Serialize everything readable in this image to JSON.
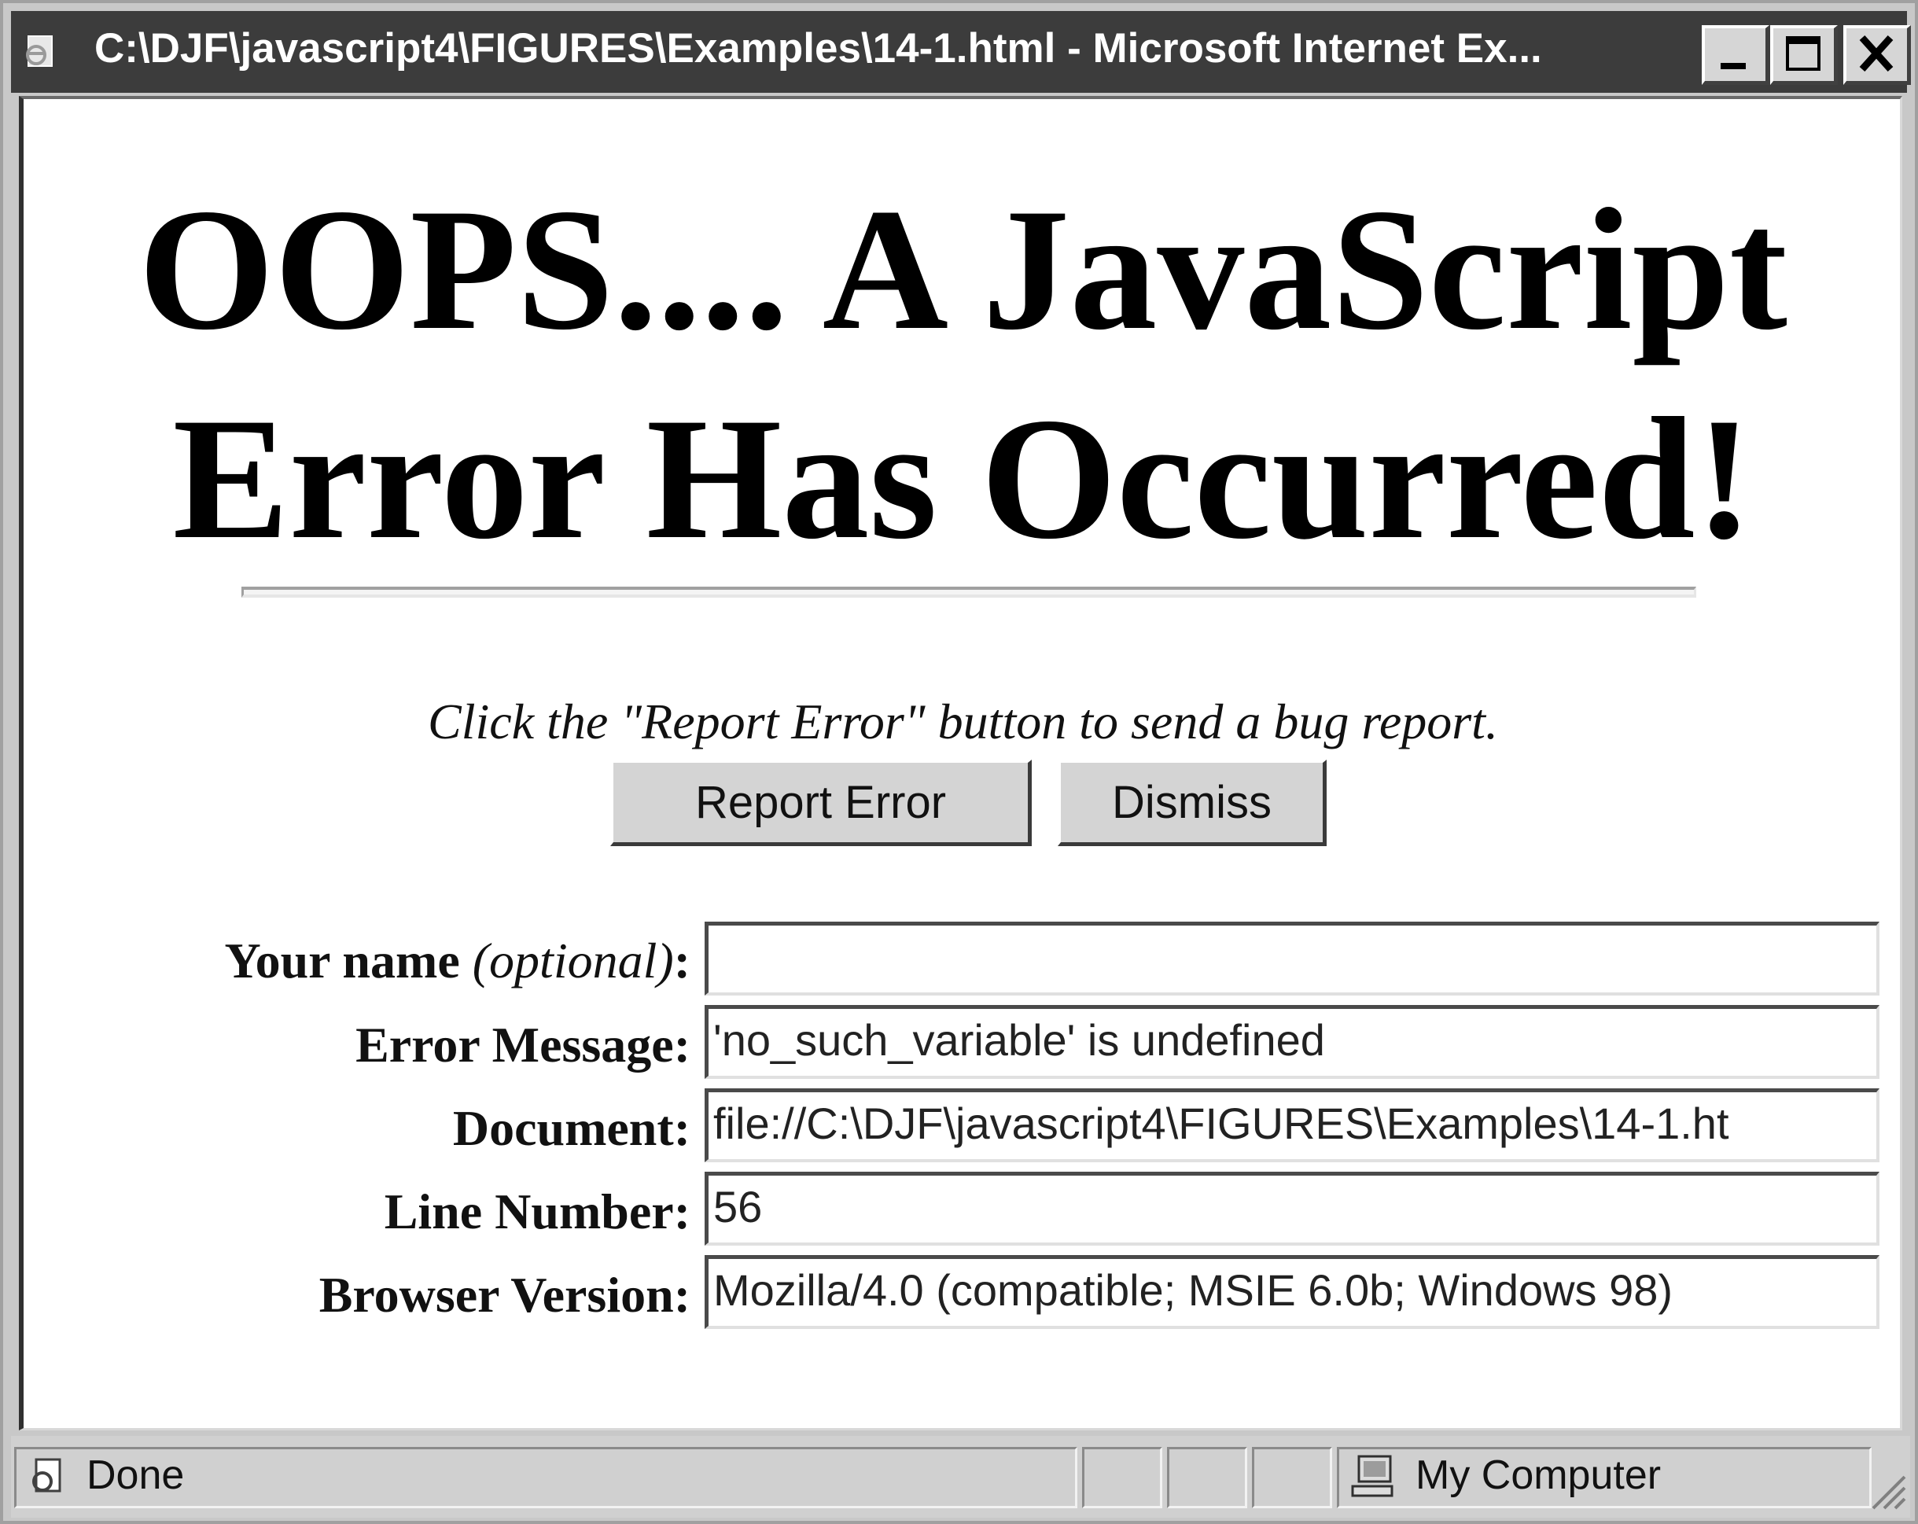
{
  "window": {
    "title": "C:\\DJF\\javascript4\\FIGURES\\Examples\\14-1.html - Microsoft Internet Ex...",
    "icon": "internet-explorer-page-icon",
    "controls": [
      "minimize-icon",
      "maximize-icon",
      "close-icon"
    ]
  },
  "page": {
    "headline_line1": "OOPS.... A JavaScript",
    "headline_line2": "Error Has Occurred!",
    "instruction": "Click the \"Report Error\" button to send a bug report.",
    "buttons": {
      "report": "Report Error",
      "dismiss": "Dismiss"
    },
    "form": {
      "name_label": "Your name ",
      "name_label_optional": "(optional)",
      "name_label_colon": ":",
      "name_value": "",
      "error_message_label": "Error Message:",
      "error_message_value": "'no_such_variable' is undefined",
      "document_label": "Document:",
      "document_value": "file://C:\\DJF\\javascript4\\FIGURES\\Examples\\14-1.ht",
      "line_number_label": "Line Number:",
      "line_number_value": "56",
      "browser_label": "Browser Version:",
      "browser_value": "Mozilla/4.0 (compatible; MSIE 6.0b; Windows 98)"
    }
  },
  "statusbar": {
    "status": "Done",
    "zone": "My Computer",
    "status_icon": "page-done-icon",
    "zone_icon": "computer-icon"
  },
  "colors": {
    "titlebar": "#3c3c3c",
    "chrome": "#d0d0d0",
    "page_background": "#ffffff"
  }
}
